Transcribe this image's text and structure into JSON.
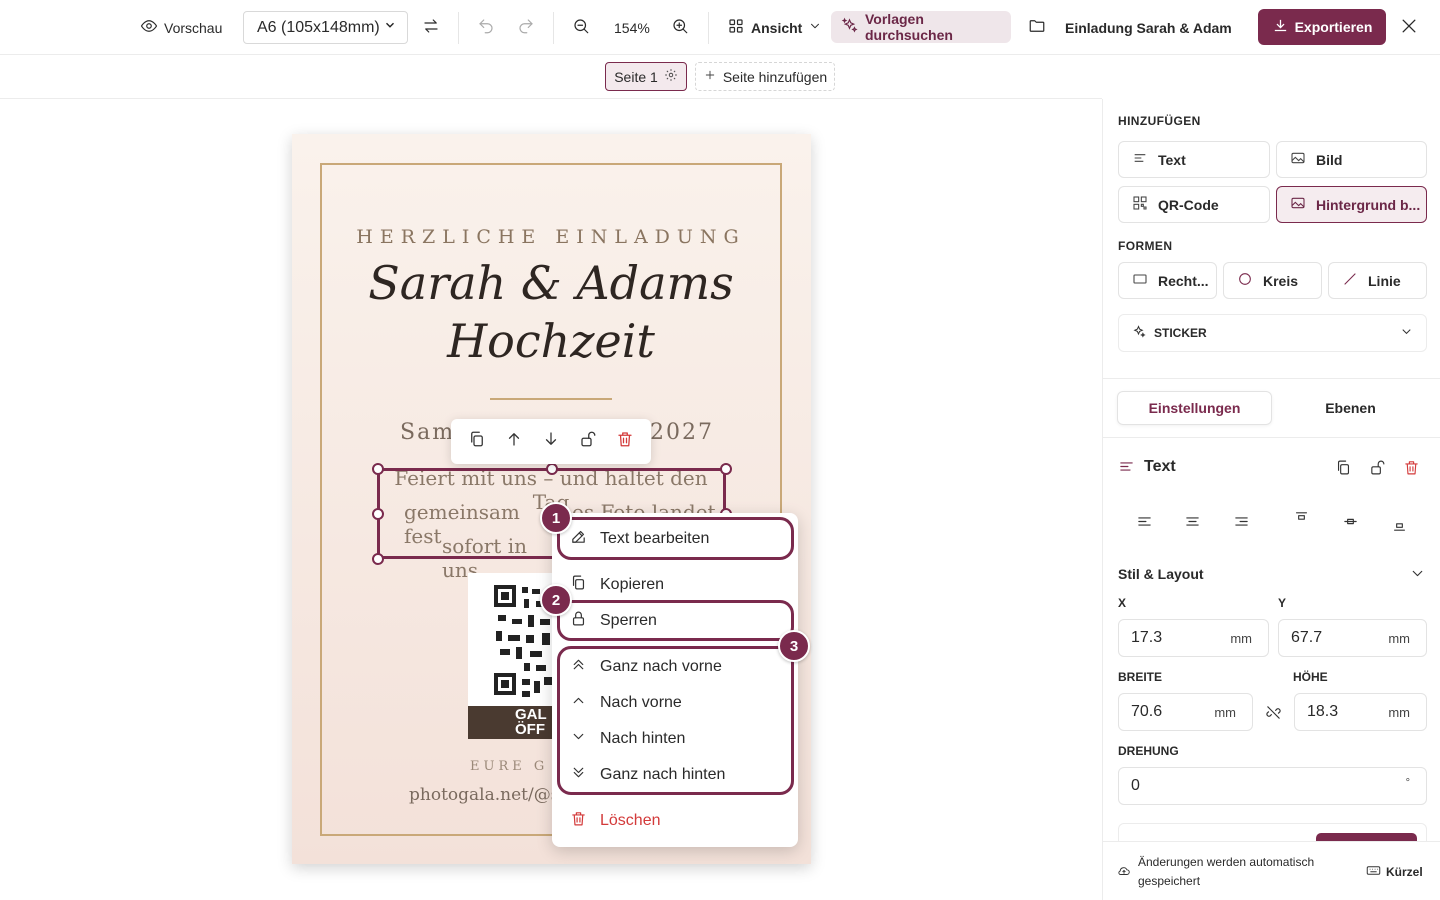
{
  "toolbar": {
    "preview_label": "Vorschau",
    "format_value": "A6 (105x148mm)",
    "zoom_value": "154%",
    "view_label": "Ansicht",
    "templates_label": "Vorlagen durchsuchen",
    "project_name": "Einladung Sarah & Adam",
    "export_label": "Exportieren"
  },
  "pages": {
    "current_label": "Seite 1",
    "add_label": "Seite hinzufügen"
  },
  "card": {
    "invite": "HERZLICHE EINLADUNG",
    "names": "Sarah & Adams",
    "wedding": "Hochzeit",
    "date_start": "Sam",
    "date_end": "2027",
    "body_line1": "Feiert mit uns – und haltet den Tag",
    "body_line2_a": "gemeinsam fest",
    "body_line2_b": "es Foto landet",
    "body_line3": "sofort in uns",
    "qr_band_1": "GAL",
    "qr_band_2": "ÖFF",
    "eure": "EURE G",
    "url": "photogala.net/@sar"
  },
  "context_menu": {
    "edit_text": "Text bearbeiten",
    "copy": "Kopieren",
    "lock": "Sperren",
    "bring_front": "Ganz nach vorne",
    "forward": "Nach vorne",
    "backward": "Nach hinten",
    "send_back": "Ganz nach hinten",
    "delete": "Löschen"
  },
  "badges": [
    "1",
    "2",
    "3"
  ],
  "panel": {
    "add_title": "HINZUFÜGEN",
    "add_text": "Text",
    "add_image": "Bild",
    "add_qr": "QR-Code",
    "add_background": "Hintergrund b...",
    "shapes_title": "FORMEN",
    "shape_rect": "Recht...",
    "shape_circle": "Kreis",
    "shape_line": "Linie",
    "sticker_title": "STICKER",
    "tab_settings": "Einstellungen",
    "tab_layers": "Ebenen",
    "element_title": "Text",
    "style_layout": "Stil & Layout",
    "x_label": "X",
    "x_value": "17.3",
    "y_label": "Y",
    "y_value": "67.7",
    "width_label": "BREITE",
    "width_value": "70.6",
    "height_label": "HÖHE",
    "height_value": "18.3",
    "rotation_label": "DREHUNG",
    "rotation_value": "0",
    "rotation_unit": "°",
    "unit_mm": "mm",
    "autosave": "Änderungen werden automatisch gespeichert",
    "shortcuts": "Kürzel"
  },
  "colors": {
    "accent": "#7a2a4d",
    "accent_light": "#f5ecef",
    "gold": "#c9a878",
    "danger": "#d33a3a"
  }
}
